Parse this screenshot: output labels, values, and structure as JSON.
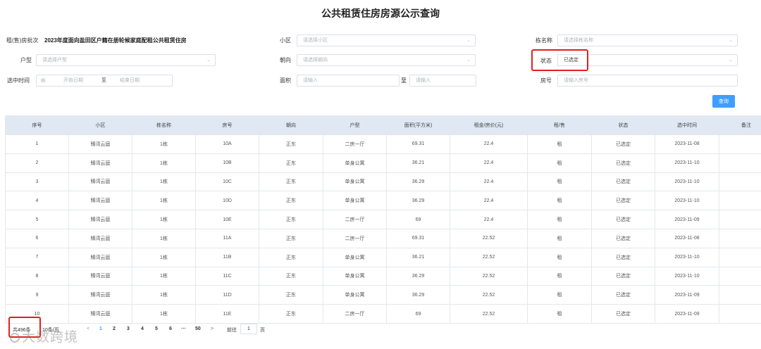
{
  "page_title": "公共租赁住房房源公示查询",
  "filters": {
    "batch_label": "租(售)房批次",
    "batch_value": "2023年度面向盐田区户籍在册轮候家庭配租公共租赁住房",
    "community_label": "小区",
    "community_placeholder": "请选择小区",
    "building_label": "栋名称",
    "building_placeholder": "请选择栋名称",
    "layout_label": "户型",
    "layout_placeholder": "请选择户型",
    "orientation_label": "朝向",
    "orientation_placeholder": "请选择朝向",
    "status_label": "状态",
    "status_value": "已选定",
    "time_label": "选中时间",
    "start_placeholder": "开始日期",
    "range_sep": "至",
    "end_placeholder": "结束日期",
    "area_label": "面积",
    "area_placeholder": "请输入",
    "area_sep": "至",
    "area_max_placeholder": "请输入",
    "room_label": "房号",
    "room_placeholder": "请输入房号",
    "search_button": "查询"
  },
  "table": {
    "headers": [
      "序号",
      "小区",
      "栋名称",
      "房号",
      "朝向",
      "户型",
      "面积(平方米)",
      "租金/房价(元)",
      "租/售",
      "状态",
      "选中时间",
      "备注"
    ],
    "rows": [
      [
        "1",
        "臻湾云庭",
        "1栋",
        "10A",
        "正东",
        "二房一厅",
        "69.31",
        "22.4",
        "租",
        "已选定",
        "2023-11-08",
        ""
      ],
      [
        "2",
        "臻湾云庭",
        "1栋",
        "10B",
        "正东",
        "单身公寓",
        "36.21",
        "22.4",
        "租",
        "已选定",
        "2023-11-10",
        ""
      ],
      [
        "3",
        "臻湾云庭",
        "1栋",
        "10C",
        "正东",
        "单身公寓",
        "36.29",
        "22.4",
        "租",
        "已选定",
        "2023-11-10",
        ""
      ],
      [
        "4",
        "臻湾云庭",
        "1栋",
        "10D",
        "正东",
        "单身公寓",
        "36.29",
        "22.4",
        "租",
        "已选定",
        "2023-11-10",
        ""
      ],
      [
        "5",
        "臻湾云庭",
        "1栋",
        "10E",
        "正东",
        "二房一厅",
        "69",
        "22.4",
        "租",
        "已选定",
        "2023-11-09",
        ""
      ],
      [
        "6",
        "臻湾云庭",
        "1栋",
        "11A",
        "正东",
        "二房一厅",
        "69.31",
        "22.52",
        "租",
        "已选定",
        "2023-11-08",
        ""
      ],
      [
        "7",
        "臻湾云庭",
        "1栋",
        "11B",
        "正东",
        "单身公寓",
        "36.21",
        "22.52",
        "租",
        "已选定",
        "2023-11-10",
        ""
      ],
      [
        "8",
        "臻湾云庭",
        "1栋",
        "11C",
        "正东",
        "单身公寓",
        "36.29",
        "22.52",
        "租",
        "已选定",
        "2023-11-10",
        ""
      ],
      [
        "9",
        "臻湾云庭",
        "1栋",
        "11D",
        "正东",
        "单身公寓",
        "36.29",
        "22.52",
        "租",
        "已选定",
        "2023-11-09",
        ""
      ],
      [
        "10",
        "臻湾云庭",
        "1栋",
        "11E",
        "正东",
        "二房一厅",
        "69",
        "22.52",
        "租",
        "已选定",
        "2023-11-09",
        ""
      ]
    ]
  },
  "pagination": {
    "total": "共496条",
    "page_size": "10条/页",
    "prev": "<",
    "pages": [
      "1",
      "2",
      "3",
      "4",
      "5",
      "6",
      "···",
      "50"
    ],
    "next": ">",
    "goto_label": "前往",
    "goto_value": "1",
    "goto_suffix": "页"
  },
  "watermark": "大数跨境",
  "colors": {
    "accent": "#409eff",
    "header_bg": "#dfe8f3",
    "highlight": "#e02020"
  }
}
